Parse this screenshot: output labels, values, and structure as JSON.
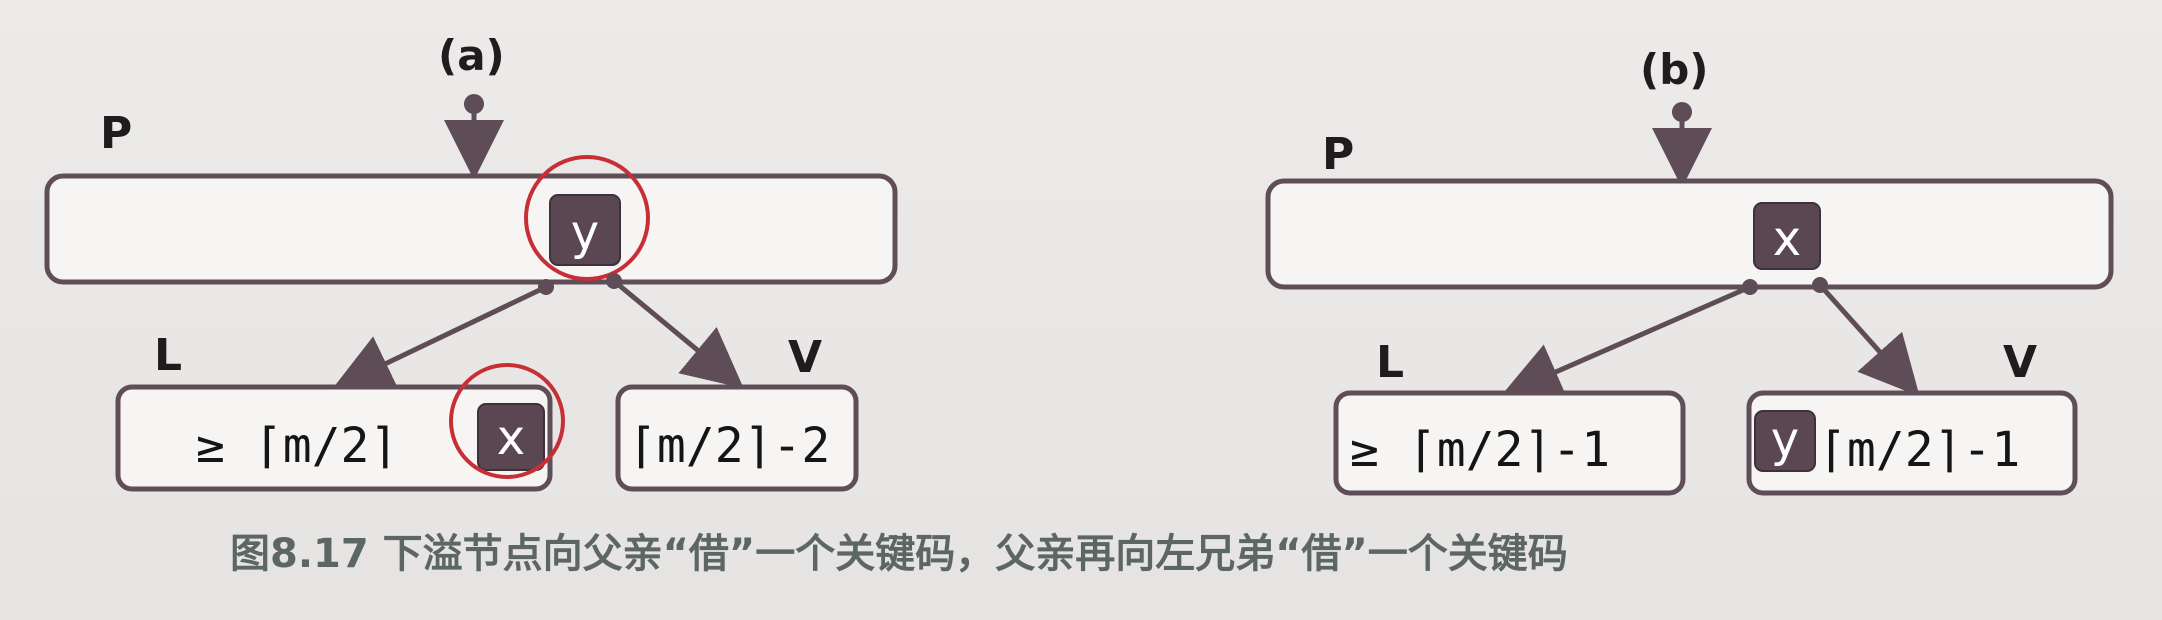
{
  "panels": [
    {
      "id": "a",
      "label": "(a)",
      "parent_label": "P",
      "parent_key": "y",
      "left_label": "L",
      "left_text": "≥ ⌈m/2⌉",
      "left_key": "x",
      "right_label": "V",
      "right_text": "⌈m/2⌉-2"
    },
    {
      "id": "b",
      "label": "(b)",
      "parent_label": "P",
      "parent_key": "x",
      "left_label": "L",
      "left_text": "≥ ⌈m/2⌉-1",
      "right_label": "V",
      "right_key": "y",
      "right_text": "⌈m/2⌉-1"
    }
  ],
  "caption": "图8.17  下溢节点向父亲“借”一个关键码，父亲再向左兄弟“借”一个关键码",
  "colors": {
    "node_border": "#5f4d58",
    "key_fill": "#5a4751",
    "annotation": "#c72f36",
    "caption": "#5c6765"
  }
}
